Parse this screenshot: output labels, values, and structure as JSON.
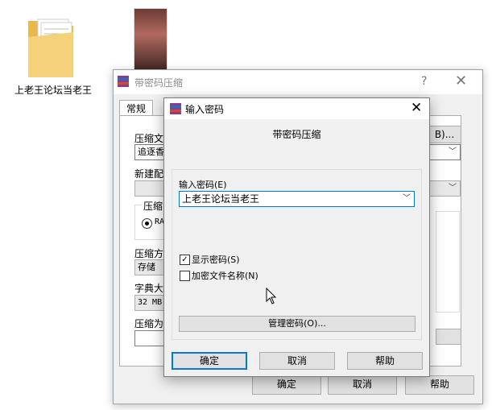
{
  "desktop": {
    "folder_label": "上老王论坛当老王"
  },
  "back_window": {
    "title": "带密码压缩",
    "help_glyph": "?",
    "close_glyph": "✕",
    "tab_general": "常规",
    "label_archive": "压缩文",
    "archive_value": "追逐香",
    "browse_button": "B)...",
    "label_profile": "新建配",
    "label_format": "压缩",
    "format_option": "RA",
    "label_method": "压缩方",
    "method_value": "存储",
    "label_dict": "字典大",
    "dict_value": "32 MB",
    "label_volume": "压缩为",
    "ok": "确定",
    "cancel": "取消",
    "help": "帮助"
  },
  "dialog": {
    "title": "输入密码",
    "close_glyph": "✕",
    "heading": "带密码压缩",
    "password_label": "输入密码(E)",
    "password_value": "上老王论坛当老王",
    "show_password_label": "显示密码(S)",
    "show_password_checked": true,
    "encrypt_names_label": "加密文件名称(N)",
    "encrypt_names_checked": false,
    "organize_button": "管理密码(O)...",
    "ok": "确定",
    "cancel": "取消",
    "help": "帮助"
  },
  "icons": [
    "folder-icon",
    "winrar-icon",
    "chevron-down-icon",
    "close-icon",
    "help-icon",
    "mouse-pointer-icon",
    "checkmark-icon"
  ]
}
